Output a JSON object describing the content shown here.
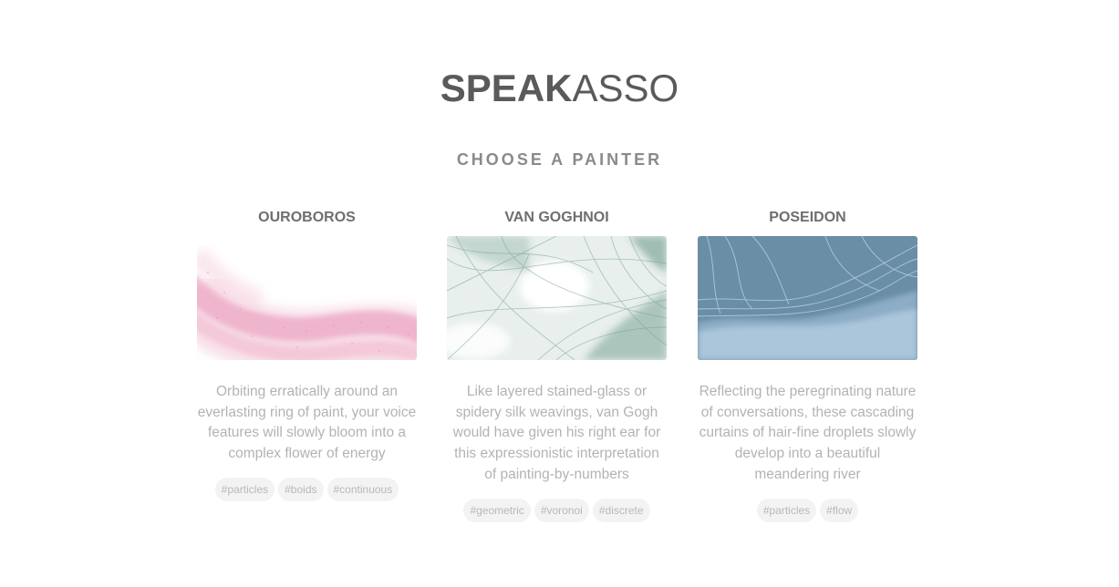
{
  "brand": {
    "bold": "SPEAK",
    "light": "ASSO"
  },
  "heading": "CHOOSE A PAINTER",
  "painters": [
    {
      "name": "OUROBOROS",
      "description": "Orbiting erratically around an everlasting ring of paint, your voice features will slowly bloom into a complex flower of energy",
      "tags": [
        "#particles",
        "#boids",
        "#continuous"
      ]
    },
    {
      "name": "VAN GOGHNOI",
      "description": "Like layered stained-glass or spidery silk weavings, van Gogh would have given his right ear for this expressionistic interpretation of painting-by-numbers",
      "tags": [
        "#geometric",
        "#voronoi",
        "#discrete"
      ]
    },
    {
      "name": "POSEIDON",
      "description": "Reflecting the peregrinating nature of conversations, these cascading curtains of hair-fine droplets slowly develop into a beautiful meandering river",
      "tags": [
        "#particles",
        "#flow"
      ]
    }
  ],
  "colors": {
    "ouroboros_accent": "#e79ab8",
    "vangoghnoi_accent": "#6f9b8c",
    "poseidon_background": "#6a8ea6",
    "poseidon_strands": "#c9def0"
  }
}
